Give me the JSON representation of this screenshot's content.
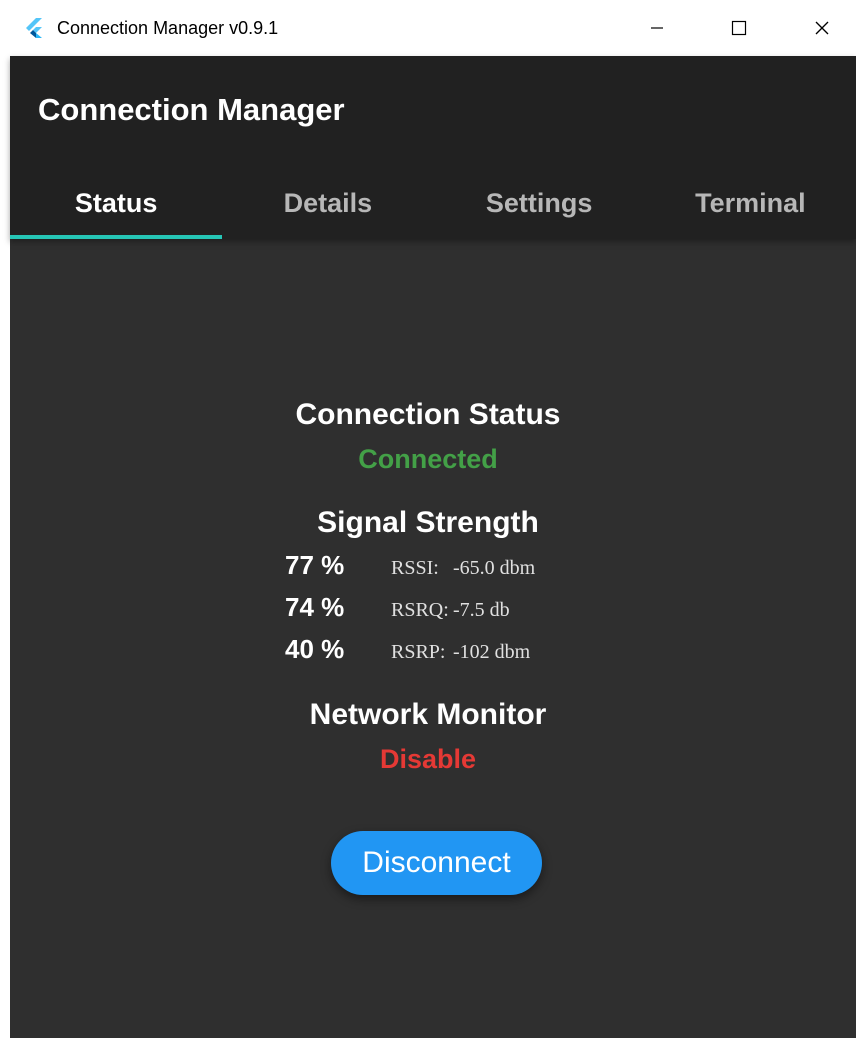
{
  "window": {
    "title": "Connection Manager v0.9.1"
  },
  "appbar": {
    "title": "Connection Manager"
  },
  "tabs": [
    {
      "label": "Status",
      "active": true
    },
    {
      "label": "Details",
      "active": false
    },
    {
      "label": "Settings",
      "active": false
    },
    {
      "label": "Terminal",
      "active": false
    }
  ],
  "status": {
    "connection_heading": "Connection Status",
    "connection_value": "Connected",
    "signal_heading": "Signal Strength",
    "signal_rows": [
      {
        "percent": "77 %",
        "name": "RSSI:",
        "value": "-65.0 dbm"
      },
      {
        "percent": "74 %",
        "name": "RSRQ:",
        "value": "-7.5 db"
      },
      {
        "percent": "40 %",
        "name": "RSRP:",
        "value": "-102 dbm"
      }
    ],
    "monitor_heading": "Network Monitor",
    "monitor_value": "Disable",
    "disconnect_label": "Disconnect"
  },
  "icons": {
    "app": "flutter-logo-icon",
    "minimize": "minimize-icon",
    "maximize": "maximize-icon",
    "close": "close-icon"
  },
  "colors": {
    "accent": "#26c6b6",
    "connected": "#43a047",
    "disabled": "#e53935",
    "button": "#2196f3",
    "appbar": "#212121",
    "background": "#2f2f2f"
  }
}
